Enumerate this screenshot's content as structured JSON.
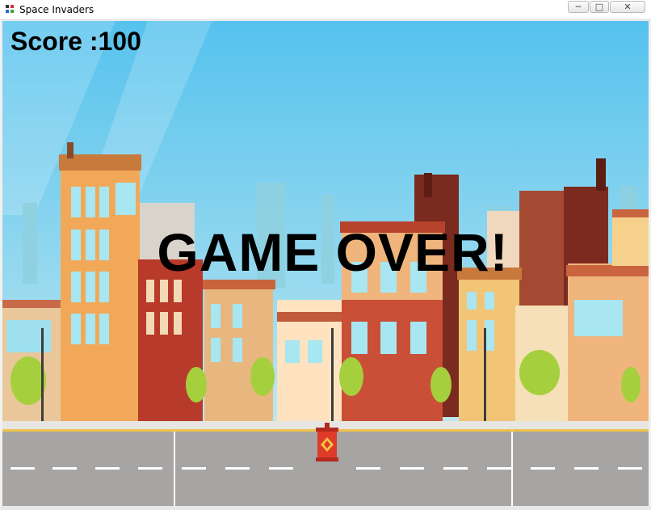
{
  "window": {
    "title": "Space Invaders",
    "controls": {
      "minimize_icon": "minimize-icon",
      "maximize_icon": "maximize-icon",
      "close_icon": "close-icon"
    }
  },
  "hud": {
    "score_text": "Score :100"
  },
  "overlay": {
    "game_over_text": "GAME OVER!"
  },
  "colors": {
    "sky_top": "#5ec4ee",
    "sky_bottom": "#cdeef4",
    "road": "#a8a8a8",
    "text": "#000000"
  }
}
